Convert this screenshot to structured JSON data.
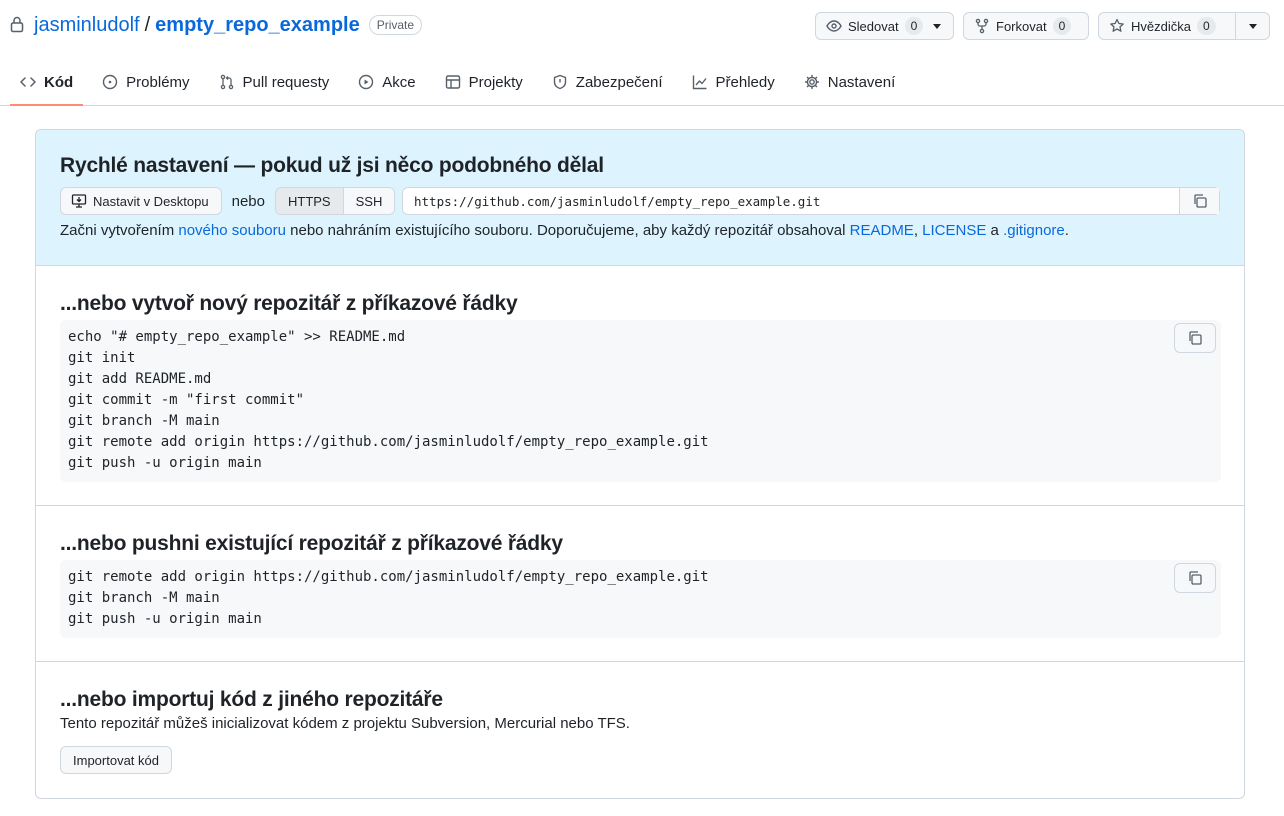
{
  "header": {
    "owner": "jasminludolf",
    "separator": "/",
    "repo": "empty_repo_example",
    "visibility": "Private",
    "watch": {
      "label": "Sledovat",
      "count": "0"
    },
    "fork": {
      "label": "Forkovat",
      "count": "0"
    },
    "star": {
      "label": "Hvězdička",
      "count": "0"
    }
  },
  "tabs": [
    {
      "label": "Kód",
      "icon": "code-icon",
      "selected": true
    },
    {
      "label": "Problémy",
      "icon": "issue-icon"
    },
    {
      "label": "Pull requesty",
      "icon": "pull-request-icon"
    },
    {
      "label": "Akce",
      "icon": "play-icon"
    },
    {
      "label": "Projekty",
      "icon": "table-icon"
    },
    {
      "label": "Zabezpečení",
      "icon": "shield-icon"
    },
    {
      "label": "Přehledy",
      "icon": "graph-icon"
    },
    {
      "label": "Nastavení",
      "icon": "gear-icon"
    }
  ],
  "quick_setup": {
    "title": "Rychlé nastavení — pokud už jsi něco podobného dělal",
    "desktop_button": "Nastavit v Desktopu",
    "or_label": "nebo",
    "https_label": "HTTPS",
    "ssh_label": "SSH",
    "clone_url": "https://github.com/jasminludolf/empty_repo_example.git",
    "desc_start": "Začni vytvořením ",
    "desc_new_file_link": "nového souboru",
    "desc_middle": " nebo nahráním existujícího souboru. Doporučujeme, aby každý repozitář obsahoval ",
    "desc_readme_link": "README",
    "desc_comma": ", ",
    "desc_license_link": "LICENSE",
    "desc_and": " a ",
    "desc_gitignore_link": ".gitignore",
    "desc_end": "."
  },
  "new_repo": {
    "title": "...nebo vytvoř nový repozitář z příkazové řádky",
    "code": "echo \"# empty_repo_example\" >> README.md\ngit init\ngit add README.md\ngit commit -m \"first commit\"\ngit branch -M main\ngit remote add origin https://github.com/jasminludolf/empty_repo_example.git\ngit push -u origin main"
  },
  "push_existing": {
    "title": "...nebo pushni existující repozitář z příkazové řádky",
    "code": "git remote add origin https://github.com/jasminludolf/empty_repo_example.git\ngit branch -M main\ngit push -u origin main"
  },
  "import": {
    "title": "...nebo importuj kód z jiného repozitáře",
    "desc": "Tento repozitář můžeš inicializovat kódem z projektu Subversion, Mercurial nebo TFS.",
    "button": "Importovat kód"
  },
  "colors": {
    "link": "#0969da",
    "quick_setup_bg": "#ddf4ff",
    "selected_tab_underline": "#fd8c73"
  }
}
